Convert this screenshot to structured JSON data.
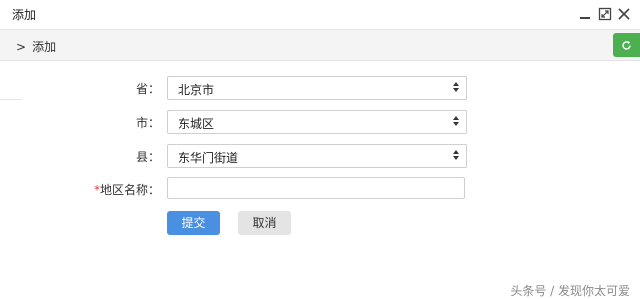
{
  "window": {
    "title": "添加",
    "minimize_icon": "minimize-icon",
    "maximize_icon": "maximize-icon",
    "close_icon": "close-icon"
  },
  "toolbar": {
    "breadcrumb_arrow": ">",
    "breadcrumb_label": "添加",
    "refresh_icon": "refresh-icon",
    "refresh_color": "#4caf50"
  },
  "form": {
    "province": {
      "label": "省：",
      "value": "北京市"
    },
    "city": {
      "label": "市：",
      "value": "东城区"
    },
    "county": {
      "label": "县：",
      "value": "东华门街道"
    },
    "region_name": {
      "required_mark": "*",
      "label": "地区名称：",
      "value": ""
    },
    "submit_label": "提交",
    "cancel_label": "取消"
  },
  "colors": {
    "primary": "#4a90e2",
    "secondary": "#e4e4e4",
    "required": "#e4393c"
  },
  "watermark": "头条号 / 发现你太可爱"
}
